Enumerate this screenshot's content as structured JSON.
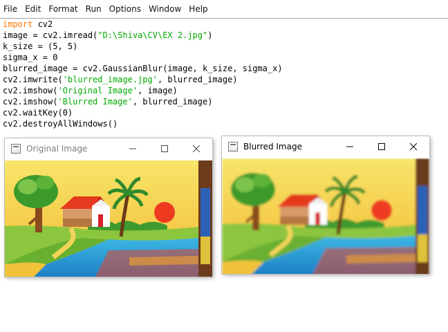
{
  "menu": [
    "File",
    "Edit",
    "Format",
    "Run",
    "Options",
    "Window",
    "Help"
  ],
  "code": {
    "line1": {
      "kw": "import",
      "rest": " cv2"
    },
    "line2": {
      "a": "image = cv2.imread(",
      "s": "\"D:\\Shiva\\CV\\EX 2.jpg\"",
      "b": ")"
    },
    "line3": "k_size = (5, 5)",
    "line4": "sigma_x = 0",
    "line5": "blurred_image = cv2.GaussianBlur(image, k_size, sigma_x)",
    "line6": {
      "a": "cv2.imwrite(",
      "s": "'blurred_image.jpg'",
      "b": ", blurred_image)"
    },
    "line7": {
      "a": "cv2.imshow(",
      "s": "'Original Image'",
      "b": ", image)"
    },
    "line8": {
      "a": "cv2.imshow(",
      "s": "'Blurred Image'",
      "b": ", blurred_image)"
    },
    "line9": "cv2.waitKey(0)",
    "line10": "cv2.destroyAllWindows()"
  },
  "windows": {
    "original": {
      "title": "Original Image",
      "title_color": "#7a7a7a"
    },
    "blurred": {
      "title": "Blurred Image",
      "title_color": "#000000"
    }
  },
  "colors": {
    "keyword": "#ff7700",
    "string": "#00aa00",
    "sky": "#f4d64a",
    "water": "#2aa7d6",
    "roof": "#e53a1e",
    "sun": "#ee3b20"
  }
}
